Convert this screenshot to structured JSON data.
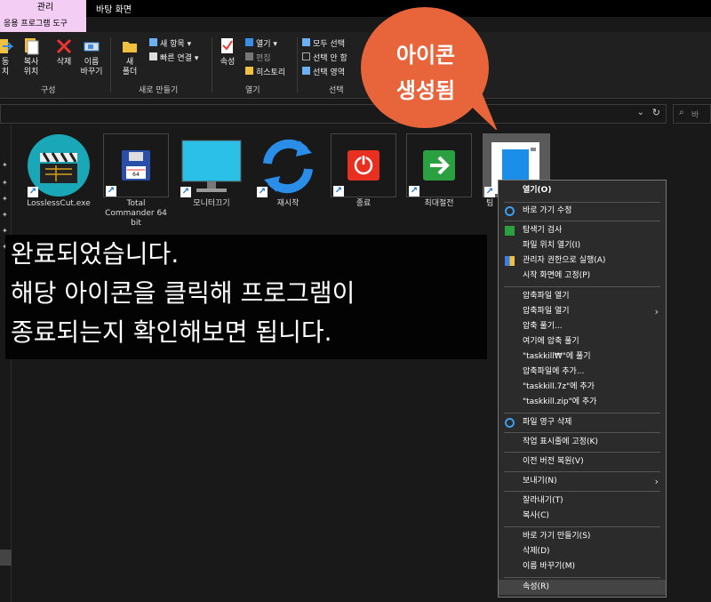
{
  "tabs": {
    "manage": "관리",
    "desktop": "바탕 화면",
    "app_tools": "응용 프로그램 도구"
  },
  "ribbon": {
    "organize": {
      "label": "구성",
      "move_partial": "동\n치",
      "copy_to": "복사\n위치",
      "delete": "삭제",
      "rename": "이름\n바꾸기"
    },
    "new": {
      "label": "새로 만들기",
      "new_folder": "새\n폴더",
      "new_item": "새 항목",
      "easy_access": "빠른 연결"
    },
    "open": {
      "label": "열기",
      "properties": "속성",
      "open": "열기",
      "edit": "편집",
      "history": "히스토리"
    },
    "select": {
      "label": "선택",
      "select_all": "모두 선택",
      "select_none": "선택 안 함",
      "invert": "선택 영역"
    }
  },
  "search": {
    "placeholder": "바"
  },
  "files": [
    {
      "name": "LosslessCut.exe"
    },
    {
      "name": "Total Commander 64 bit"
    },
    {
      "name": "모니터끄기"
    },
    {
      "name": "재시작"
    },
    {
      "name": "종료"
    },
    {
      "name": "최대절전"
    },
    {
      "name": "팀"
    }
  ],
  "overlay": {
    "line1": "완료되었습니다.",
    "line2": "해당 아이콘을 클릭해 프로그램이",
    "line3": "종료되는지 확인해보면 됩니다."
  },
  "bubble": {
    "line1": "아이콘",
    "line2": "생성됨"
  },
  "context_menu": {
    "open": "열기(O)",
    "edit_shortcut": "바로 가기 수정",
    "explorer_search": "탐색기 검사",
    "open_location": "파일 위치 열기(I)",
    "run_admin": "관리자 권한으로 실행(A)",
    "pin_start": "시작 화면에 고정(P)",
    "zip_open": "압축파일 열기",
    "zip_open2": "압축파일 열기",
    "extract": "압축 풀기...",
    "extract_here": "여기에 압축 풀기",
    "extract_to": "\"taskkill₩\"에 풀기",
    "add_archive": "압축파일에 추가...",
    "add_7z": "\"taskkill.7z\"에 추가",
    "add_zip": "\"taskkill.zip\"에 추가",
    "delete_perm": "파일 영구 삭제",
    "pin_taskbar": "작업 표시줄에 고정(K)",
    "restore_prev": "이전 버전 복원(V)",
    "send_to": "보내기(N)",
    "cut": "잘라내기(T)",
    "copy": "복사(C)",
    "create_shortcut": "바로 가기 만들기(S)",
    "delete": "삭제(D)",
    "rename": "이름 바꾸기(M)",
    "properties": "속성(R)"
  },
  "colors": {
    "bubble": "#e8643a",
    "manage_tab": "#f3cdf3",
    "background": "#191919"
  }
}
